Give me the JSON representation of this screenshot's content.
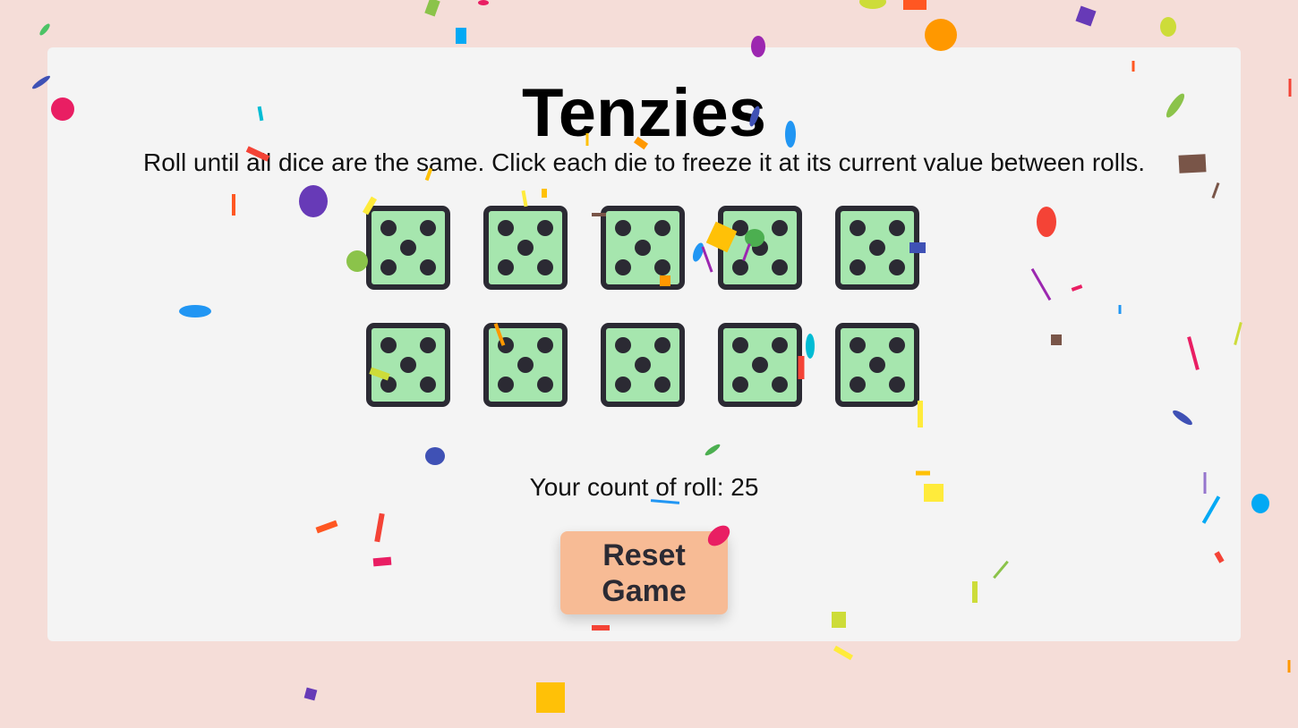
{
  "game": {
    "title": "Tenzies",
    "instructions": "Roll until all dice are the same. Click each die to freeze it at its current value between rolls.",
    "roll_count_text": "Your count of roll: 25",
    "reset_label": "Reset Game"
  },
  "dice": [
    {
      "value": 5,
      "held": true
    },
    {
      "value": 5,
      "held": true
    },
    {
      "value": 5,
      "held": true
    },
    {
      "value": 5,
      "held": true
    },
    {
      "value": 5,
      "held": true
    },
    {
      "value": 5,
      "held": true
    },
    {
      "value": 5,
      "held": true
    },
    {
      "value": 5,
      "held": true
    },
    {
      "value": 5,
      "held": true
    },
    {
      "value": 5,
      "held": true
    }
  ],
  "colors": {
    "background": "#f5ddd8",
    "card": "#f4f4f4",
    "die_held": "#a6e6ae",
    "die_border": "#2b2a33",
    "button": "#f7bb95"
  },
  "icons": {
    "confetti": "confetti-pieces"
  }
}
